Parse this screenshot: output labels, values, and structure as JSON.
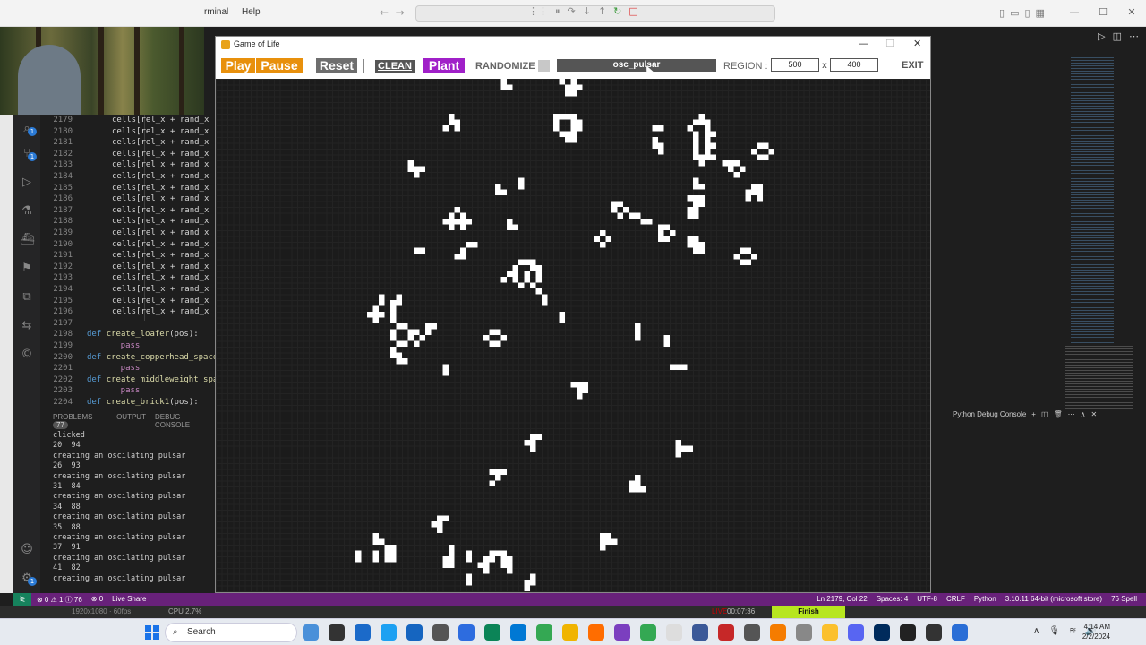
{
  "vscode": {
    "menu": [
      "rminal",
      "Help"
    ],
    "code_lines": [
      {
        "n": "2179",
        "code": "cells[rel_x + rand_x"
      },
      {
        "n": "2180",
        "code": "cells[rel_x + rand_x"
      },
      {
        "n": "2181",
        "code": "cells[rel_x + rand_x"
      },
      {
        "n": "2182",
        "code": "cells[rel_x + rand_x"
      },
      {
        "n": "2183",
        "code": "cells[rel_x + rand_x"
      },
      {
        "n": "2184",
        "code": "cells[rel_x + rand_x"
      },
      {
        "n": "2185",
        "code": "cells[rel_x + rand_x"
      },
      {
        "n": "2186",
        "code": "cells[rel_x + rand_x"
      },
      {
        "n": "2187",
        "code": "cells[rel_x + rand_x"
      },
      {
        "n": "2188",
        "code": "cells[rel_x + rand_x"
      },
      {
        "n": "2189",
        "code": "cells[rel_x + rand_x"
      },
      {
        "n": "2190",
        "code": "cells[rel_x + rand_x"
      },
      {
        "n": "2191",
        "code": "cells[rel_x + rand_x"
      },
      {
        "n": "2192",
        "code": "cells[rel_x + rand_x"
      },
      {
        "n": "2193",
        "code": "cells[rel_x + rand_x"
      },
      {
        "n": "2194",
        "code": "cells[rel_x + rand_x"
      },
      {
        "n": "2195",
        "code": "cells[rel_x + rand_x"
      },
      {
        "n": "2196",
        "code": "cells[rel_x + rand_x"
      },
      {
        "n": "2197",
        "code": ""
      },
      {
        "n": "2198",
        "code": "def create_loafer(pos):"
      },
      {
        "n": "2199",
        "code": "    pass"
      },
      {
        "n": "2200",
        "code": "def create_copperhead_spaces"
      },
      {
        "n": "2201",
        "code": "    pass"
      },
      {
        "n": "2202",
        "code": "def create_middleweight_spac"
      },
      {
        "n": "2203",
        "code": "    pass"
      },
      {
        "n": "2204",
        "code": "def create_brick1(pos):"
      }
    ],
    "panel_tabs": {
      "problems": "PROBLEMS",
      "problems_count": "77",
      "output": "OUTPUT",
      "debug_console": "DEBUG CONSOLE"
    },
    "terminal_lines": [
      "clicked",
      "20  94",
      "creating an oscilating pulsar",
      "26  93",
      "creating an oscilating pulsar",
      "31  84",
      "creating an oscilating pulsar",
      "34  88",
      "creating an oscilating pulsar",
      "35  88",
      "creating an oscilating pulsar",
      "37  91",
      "creating an oscilating pulsar",
      "41  82",
      "creating an oscilating pulsar"
    ],
    "right_panel_title": "Python Debug Console",
    "status_left": [
      "⊗ 0 ⚠ 1 ⓘ 76",
      "⊗ 0",
      "Live Share"
    ],
    "status_right": [
      "Ln 2179, Col 22",
      "Spaces: 4",
      "UTF-8",
      "CRLF",
      "Python",
      "3.10.11 64-bit (microsoft store)",
      "76 Spell"
    ]
  },
  "obs": {
    "resolution": "1920x1080 · 60fps",
    "cpu": "CPU 2.7%",
    "live": "LIVE",
    "timer": "00:07:36",
    "finish": "Finish"
  },
  "taskbar": {
    "search_label": "Search",
    "time": "4:14 AM",
    "date": "2/2/2024"
  },
  "gol": {
    "title": "Game of Life",
    "buttons": {
      "play": "Play",
      "pause": "Pause",
      "reset": "Reset",
      "clean": "CLEAN",
      "plant": "Plant",
      "exit": "EXIT"
    },
    "randomize_label": "RANDOMIZE",
    "pattern": "osc_pulsar",
    "region_label": "REGION :",
    "region_width": "500",
    "region_height": "400",
    "region_sep": "x",
    "colors": {
      "play": "#e8900c",
      "plant": "#a020c8",
      "cell": "#ffffff",
      "background": "#1b1b1b"
    },
    "live_cells": [
      [
        49,
        1
      ],
      [
        50,
        1
      ],
      [
        49,
        0
      ],
      [
        59,
        0
      ],
      [
        61,
        0
      ],
      [
        60,
        1
      ],
      [
        61,
        1
      ],
      [
        62,
        1
      ],
      [
        60,
        2
      ],
      [
        61,
        2
      ],
      [
        40,
        6
      ],
      [
        40,
        7
      ],
      [
        41,
        7
      ],
      [
        39,
        8
      ],
      [
        41,
        8
      ],
      [
        58,
        6
      ],
      [
        59,
        6
      ],
      [
        60,
        6
      ],
      [
        61,
        6
      ],
      [
        58,
        7
      ],
      [
        61,
        7
      ],
      [
        62,
        7
      ],
      [
        58,
        8
      ],
      [
        61,
        8
      ],
      [
        62,
        8
      ],
      [
        59,
        9
      ],
      [
        60,
        9
      ],
      [
        61,
        9
      ],
      [
        60,
        10
      ],
      [
        61,
        10
      ],
      [
        75,
        8
      ],
      [
        76,
        8
      ],
      [
        75,
        10
      ],
      [
        75,
        11
      ],
      [
        76,
        11
      ],
      [
        76,
        12
      ],
      [
        83,
        6
      ],
      [
        82,
        7
      ],
      [
        83,
        7
      ],
      [
        84,
        7
      ],
      [
        81,
        8
      ],
      [
        84,
        8
      ],
      [
        82,
        9
      ],
      [
        84,
        9
      ],
      [
        85,
        9
      ],
      [
        82,
        10
      ],
      [
        84,
        10
      ],
      [
        82,
        11
      ],
      [
        84,
        11
      ],
      [
        85,
        11
      ],
      [
        82,
        12
      ],
      [
        84,
        12
      ],
      [
        82,
        13
      ],
      [
        83,
        13
      ],
      [
        84,
        13
      ],
      [
        85,
        13
      ],
      [
        83,
        14
      ],
      [
        93,
        11
      ],
      [
        94,
        11
      ],
      [
        92,
        12
      ],
      [
        95,
        12
      ],
      [
        93,
        13
      ],
      [
        94,
        13
      ],
      [
        87,
        14
      ],
      [
        88,
        14
      ],
      [
        89,
        14
      ],
      [
        88,
        15
      ],
      [
        90,
        15
      ],
      [
        89,
        16
      ],
      [
        33,
        14
      ],
      [
        33,
        15
      ],
      [
        34,
        15
      ],
      [
        35,
        15
      ],
      [
        34,
        16
      ],
      [
        48,
        18
      ],
      [
        48,
        19
      ],
      [
        49,
        19
      ],
      [
        52,
        17
      ],
      [
        52,
        18
      ],
      [
        81,
        20
      ],
      [
        82,
        20
      ],
      [
        83,
        20
      ],
      [
        82,
        21
      ],
      [
        83,
        21
      ],
      [
        81,
        22
      ],
      [
        82,
        22
      ],
      [
        81,
        23
      ],
      [
        82,
        23
      ],
      [
        82,
        17
      ],
      [
        82,
        18
      ],
      [
        83,
        18
      ],
      [
        92,
        18
      ],
      [
        93,
        18
      ],
      [
        91,
        19
      ],
      [
        92,
        19
      ],
      [
        93,
        19
      ],
      [
        91,
        20
      ],
      [
        93,
        20
      ],
      [
        41,
        22
      ],
      [
        40,
        23
      ],
      [
        42,
        23
      ],
      [
        39,
        24
      ],
      [
        40,
        24
      ],
      [
        41,
        24
      ],
      [
        42,
        24
      ],
      [
        43,
        24
      ],
      [
        40,
        25
      ],
      [
        42,
        25
      ],
      [
        50,
        24
      ],
      [
        50,
        25
      ],
      [
        51,
        25
      ],
      [
        68,
        21
      ],
      [
        69,
        21
      ],
      [
        68,
        22
      ],
      [
        70,
        22
      ],
      [
        69,
        23
      ],
      [
        71,
        23
      ],
      [
        72,
        23
      ],
      [
        73,
        24
      ],
      [
        74,
        24
      ],
      [
        76,
        25
      ],
      [
        77,
        25
      ],
      [
        76,
        26
      ],
      [
        78,
        26
      ],
      [
        76,
        27
      ],
      [
        77,
        27
      ],
      [
        66,
        26
      ],
      [
        65,
        27
      ],
      [
        67,
        27
      ],
      [
        66,
        28
      ],
      [
        43,
        28
      ],
      [
        44,
        28
      ],
      [
        42,
        29
      ],
      [
        41,
        30
      ],
      [
        42,
        30
      ],
      [
        52,
        31
      ],
      [
        53,
        31
      ],
      [
        54,
        31
      ],
      [
        51,
        32
      ],
      [
        54,
        32
      ],
      [
        55,
        32
      ],
      [
        50,
        33
      ],
      [
        51,
        33
      ],
      [
        53,
        33
      ],
      [
        55,
        33
      ],
      [
        49,
        34
      ],
      [
        51,
        34
      ],
      [
        53,
        34
      ],
      [
        55,
        34
      ],
      [
        52,
        35
      ],
      [
        54,
        35
      ],
      [
        34,
        29
      ],
      [
        35,
        29
      ],
      [
        81,
        27
      ],
      [
        82,
        27
      ],
      [
        81,
        28
      ],
      [
        82,
        28
      ],
      [
        83,
        28
      ],
      [
        82,
        29
      ],
      [
        83,
        29
      ],
      [
        90,
        29
      ],
      [
        91,
        29
      ],
      [
        89,
        30
      ],
      [
        92,
        30
      ],
      [
        90,
        31
      ],
      [
        91,
        31
      ],
      [
        53,
        34
      ],
      [
        28,
        37
      ],
      [
        28,
        38
      ],
      [
        27,
        39
      ],
      [
        26,
        40
      ],
      [
        27,
        40
      ],
      [
        28,
        40
      ],
      [
        27,
        41
      ],
      [
        31,
        37
      ],
      [
        31,
        38
      ],
      [
        30,
        38
      ],
      [
        30,
        39
      ],
      [
        30,
        40
      ],
      [
        30,
        41
      ],
      [
        55,
        36
      ],
      [
        56,
        37
      ],
      [
        56,
        38
      ],
      [
        59,
        40
      ],
      [
        59,
        41
      ],
      [
        31,
        42
      ],
      [
        32,
        42
      ],
      [
        30,
        43
      ],
      [
        33,
        43
      ],
      [
        34,
        43
      ],
      [
        30,
        44
      ],
      [
        33,
        44
      ],
      [
        35,
        44
      ],
      [
        31,
        45
      ],
      [
        32,
        45
      ],
      [
        34,
        45
      ],
      [
        36,
        42
      ],
      [
        37,
        42
      ],
      [
        36,
        43
      ],
      [
        47,
        43
      ],
      [
        48,
        43
      ],
      [
        46,
        44
      ],
      [
        49,
        44
      ],
      [
        47,
        45
      ],
      [
        48,
        45
      ],
      [
        30,
        46
      ],
      [
        30,
        47
      ],
      [
        31,
        47
      ],
      [
        31,
        48
      ],
      [
        32,
        48
      ],
      [
        72,
        42
      ],
      [
        72,
        43
      ],
      [
        72,
        44
      ],
      [
        77,
        44
      ],
      [
        77,
        45
      ],
      [
        39,
        49
      ],
      [
        39,
        50
      ],
      [
        78,
        49
      ],
      [
        79,
        49
      ],
      [
        80,
        49
      ],
      [
        61,
        52
      ],
      [
        62,
        52
      ],
      [
        63,
        52
      ],
      [
        62,
        53
      ],
      [
        63,
        53
      ],
      [
        62,
        54
      ],
      [
        54,
        61
      ],
      [
        55,
        61
      ],
      [
        53,
        62
      ],
      [
        54,
        62
      ],
      [
        54,
        63
      ],
      [
        79,
        62
      ],
      [
        79,
        63
      ],
      [
        80,
        63
      ],
      [
        81,
        63
      ],
      [
        79,
        64
      ],
      [
        47,
        67
      ],
      [
        48,
        67
      ],
      [
        49,
        67
      ],
      [
        48,
        68
      ],
      [
        47,
        69
      ],
      [
        72,
        68
      ],
      [
        71,
        69
      ],
      [
        72,
        69
      ],
      [
        71,
        70
      ],
      [
        72,
        70
      ],
      [
        73,
        70
      ],
      [
        38,
        75
      ],
      [
        39,
        75
      ],
      [
        37,
        76
      ],
      [
        38,
        76
      ],
      [
        38,
        77
      ],
      [
        27,
        78
      ],
      [
        27,
        79
      ],
      [
        28,
        79
      ],
      [
        29,
        80
      ],
      [
        30,
        80
      ],
      [
        27,
        81
      ],
      [
        29,
        81
      ],
      [
        30,
        81
      ],
      [
        27,
        82
      ],
      [
        29,
        82
      ],
      [
        30,
        82
      ],
      [
        24,
        81
      ],
      [
        24,
        82
      ],
      [
        40,
        80
      ],
      [
        40,
        81
      ],
      [
        39,
        82
      ],
      [
        40,
        82
      ],
      [
        39,
        83
      ],
      [
        40,
        83
      ],
      [
        43,
        81
      ],
      [
        43,
        82
      ],
      [
        47,
        81
      ],
      [
        48,
        81
      ],
      [
        49,
        81
      ],
      [
        46,
        82
      ],
      [
        47,
        82
      ],
      [
        49,
        82
      ],
      [
        50,
        82
      ],
      [
        45,
        83
      ],
      [
        46,
        83
      ],
      [
        49,
        83
      ],
      [
        50,
        83
      ],
      [
        46,
        84
      ],
      [
        50,
        84
      ],
      [
        43,
        85
      ],
      [
        43,
        86
      ],
      [
        54,
        85
      ],
      [
        53,
        86
      ],
      [
        54,
        86
      ],
      [
        53,
        87
      ],
      [
        66,
        78
      ],
      [
        67,
        78
      ],
      [
        66,
        79
      ],
      [
        67,
        79
      ],
      [
        68,
        79
      ],
      [
        66,
        80
      ]
    ]
  }
}
